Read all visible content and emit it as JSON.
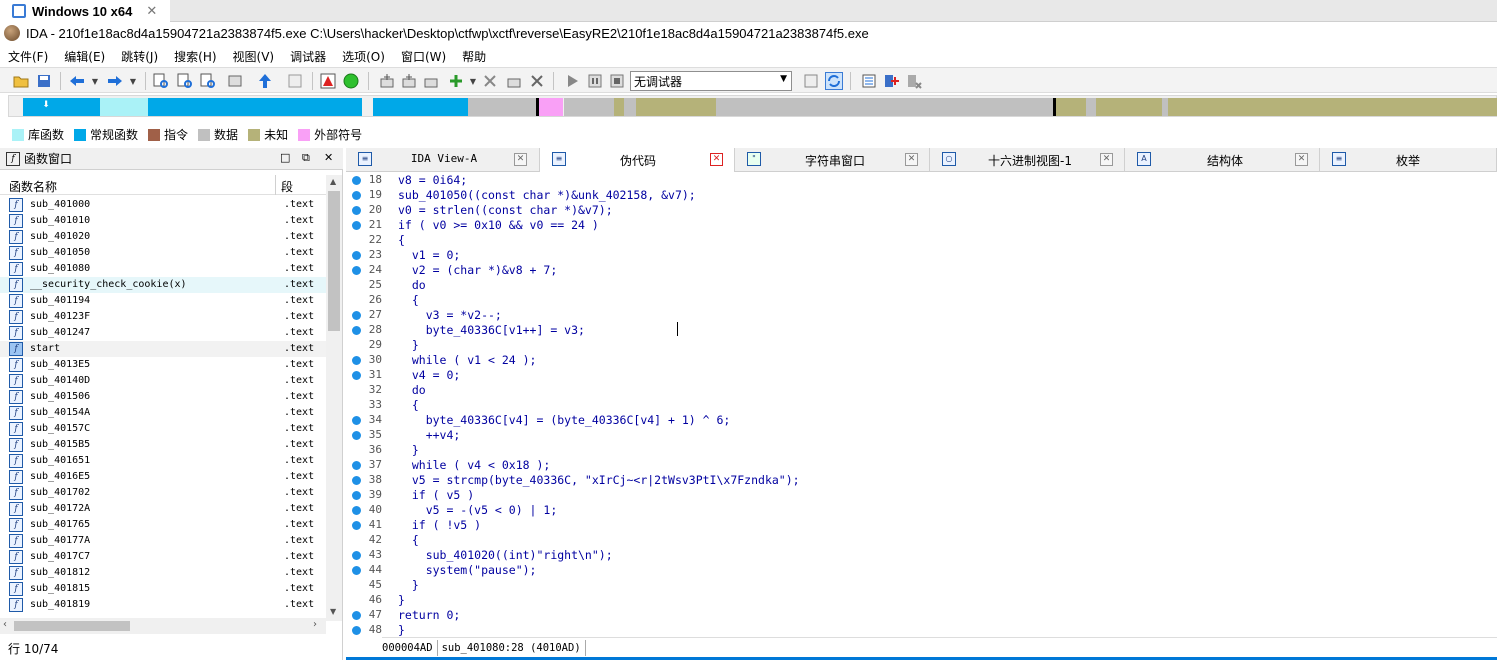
{
  "vm": {
    "tab_title": "Windows 10 x64",
    "close": "✕"
  },
  "window": {
    "title": "IDA - 210f1e18ac8d4a15904721a2383874f5.exe C:\\Users\\hacker\\Desktop\\ctfwp\\xctf\\reverse\\EasyRE2\\210f1e18ac8d4a15904721a2383874f5.exe"
  },
  "menu": [
    "文件(F)",
    "编辑(E)",
    "跳转(J)",
    "搜索(H)",
    "视图(V)",
    "调试器",
    "选项(O)",
    "窗口(W)",
    "帮助"
  ],
  "toolbar": {
    "debugger_select": "无调试器"
  },
  "legend": [
    {
      "label": "库函数",
      "color": "#aaf2f7"
    },
    {
      "label": "常规函数",
      "color": "#00a8e8"
    },
    {
      "label": "指令",
      "color": "#a06048"
    },
    {
      "label": "数据",
      "color": "#c0c0c0"
    },
    {
      "label": "未知",
      "color": "#b5b279"
    },
    {
      "label": "外部符号",
      "color": "#f9a0f6"
    }
  ],
  "functions_panel": {
    "title": "函数窗口",
    "col_name": "函数名称",
    "col_segment": "段",
    "rows": [
      {
        "name": "sub_401000",
        "seg": ".text"
      },
      {
        "name": "sub_401010",
        "seg": ".text"
      },
      {
        "name": "sub_401020",
        "seg": ".text"
      },
      {
        "name": "sub_401050",
        "seg": ".text"
      },
      {
        "name": "sub_401080",
        "seg": ".text"
      },
      {
        "name": "__security_check_cookie(x)",
        "seg": ".text"
      },
      {
        "name": "sub_401194",
        "seg": ".text"
      },
      {
        "name": "sub_40123F",
        "seg": ".text"
      },
      {
        "name": "sub_401247",
        "seg": ".text"
      },
      {
        "name": "start",
        "seg": ".text"
      },
      {
        "name": "sub_4013E5",
        "seg": ".text"
      },
      {
        "name": "sub_40140D",
        "seg": ".text"
      },
      {
        "name": "sub_401506",
        "seg": ".text"
      },
      {
        "name": "sub_40154A",
        "seg": ".text"
      },
      {
        "name": "sub_40157C",
        "seg": ".text"
      },
      {
        "name": "sub_4015B5",
        "seg": ".text"
      },
      {
        "name": "sub_401651",
        "seg": ".text"
      },
      {
        "name": "sub_4016E5",
        "seg": ".text"
      },
      {
        "name": "sub_401702",
        "seg": ".text"
      },
      {
        "name": "sub_40172A",
        "seg": ".text"
      },
      {
        "name": "sub_401765",
        "seg": ".text"
      },
      {
        "name": "sub_40177A",
        "seg": ".text"
      },
      {
        "name": "sub_4017C7",
        "seg": ".text"
      },
      {
        "name": "sub_401812",
        "seg": ".text"
      },
      {
        "name": "sub_401815",
        "seg": ".text"
      },
      {
        "name": "sub_401819",
        "seg": ".text"
      }
    ],
    "status": "行 10/74"
  },
  "tabs": [
    {
      "label": "IDA View-A"
    },
    {
      "label": "伪代码"
    },
    {
      "label": "字符串窗口"
    },
    {
      "label": "十六进制视图-1"
    },
    {
      "label": "结构体"
    },
    {
      "label": "枚举"
    }
  ],
  "code_lines": [
    {
      "n": "18",
      "dot": true,
      "t": "v8 = 0i64;"
    },
    {
      "n": "19",
      "dot": true,
      "t": "sub_401050((const char *)&unk_402158, &v7);"
    },
    {
      "n": "20",
      "dot": true,
      "t": "v0 = strlen((const char *)&v7);"
    },
    {
      "n": "21",
      "dot": true,
      "t": "if ( v0 >= 0x10 && v0 == 24 )"
    },
    {
      "n": "22",
      "dot": false,
      "t": "{"
    },
    {
      "n": "23",
      "dot": true,
      "t": "  v1 = 0;"
    },
    {
      "n": "24",
      "dot": true,
      "t": "  v2 = (char *)&v8 + 7;"
    },
    {
      "n": "25",
      "dot": false,
      "t": "  do"
    },
    {
      "n": "26",
      "dot": false,
      "t": "  {"
    },
    {
      "n": "27",
      "dot": true,
      "t": "    v3 = *v2--;"
    },
    {
      "n": "28",
      "dot": true,
      "t": "    byte_40336C[v1++] = v3;"
    },
    {
      "n": "29",
      "dot": false,
      "t": "  }"
    },
    {
      "n": "30",
      "dot": true,
      "t": "  while ( v1 < 24 );"
    },
    {
      "n": "31",
      "dot": true,
      "t": "  v4 = 0;"
    },
    {
      "n": "32",
      "dot": false,
      "t": "  do"
    },
    {
      "n": "33",
      "dot": false,
      "t": "  {"
    },
    {
      "n": "34",
      "dot": true,
      "t": "    byte_40336C[v4] = (byte_40336C[v4] + 1) ^ 6;"
    },
    {
      "n": "35",
      "dot": true,
      "t": "    ++v4;"
    },
    {
      "n": "36",
      "dot": false,
      "t": "  }"
    },
    {
      "n": "37",
      "dot": true,
      "t": "  while ( v4 < 0x18 );"
    },
    {
      "n": "38",
      "dot": true,
      "t": "  v5 = strcmp(byte_40336C, \"xIrCj~<r|2tWsv3PtI\\x7Fzndka\");"
    },
    {
      "n": "39",
      "dot": true,
      "t": "  if ( v5 )"
    },
    {
      "n": "40",
      "dot": true,
      "t": "    v5 = -(v5 < 0) | 1;"
    },
    {
      "n": "41",
      "dot": true,
      "t": "  if ( !v5 )"
    },
    {
      "n": "42",
      "dot": false,
      "t": "  {"
    },
    {
      "n": "43",
      "dot": true,
      "t": "    sub_401020((int)\"right\\n\");"
    },
    {
      "n": "44",
      "dot": true,
      "t": "    system(\"pause\");"
    },
    {
      "n": "45",
      "dot": false,
      "t": "  }"
    },
    {
      "n": "46",
      "dot": false,
      "t": "}"
    },
    {
      "n": "47",
      "dot": true,
      "t": "return 0;"
    },
    {
      "n": "48",
      "dot": true,
      "t": "}"
    }
  ],
  "code_status": {
    "offset": "000004AD",
    "location": "sub_401080:28 (4010AD)"
  }
}
